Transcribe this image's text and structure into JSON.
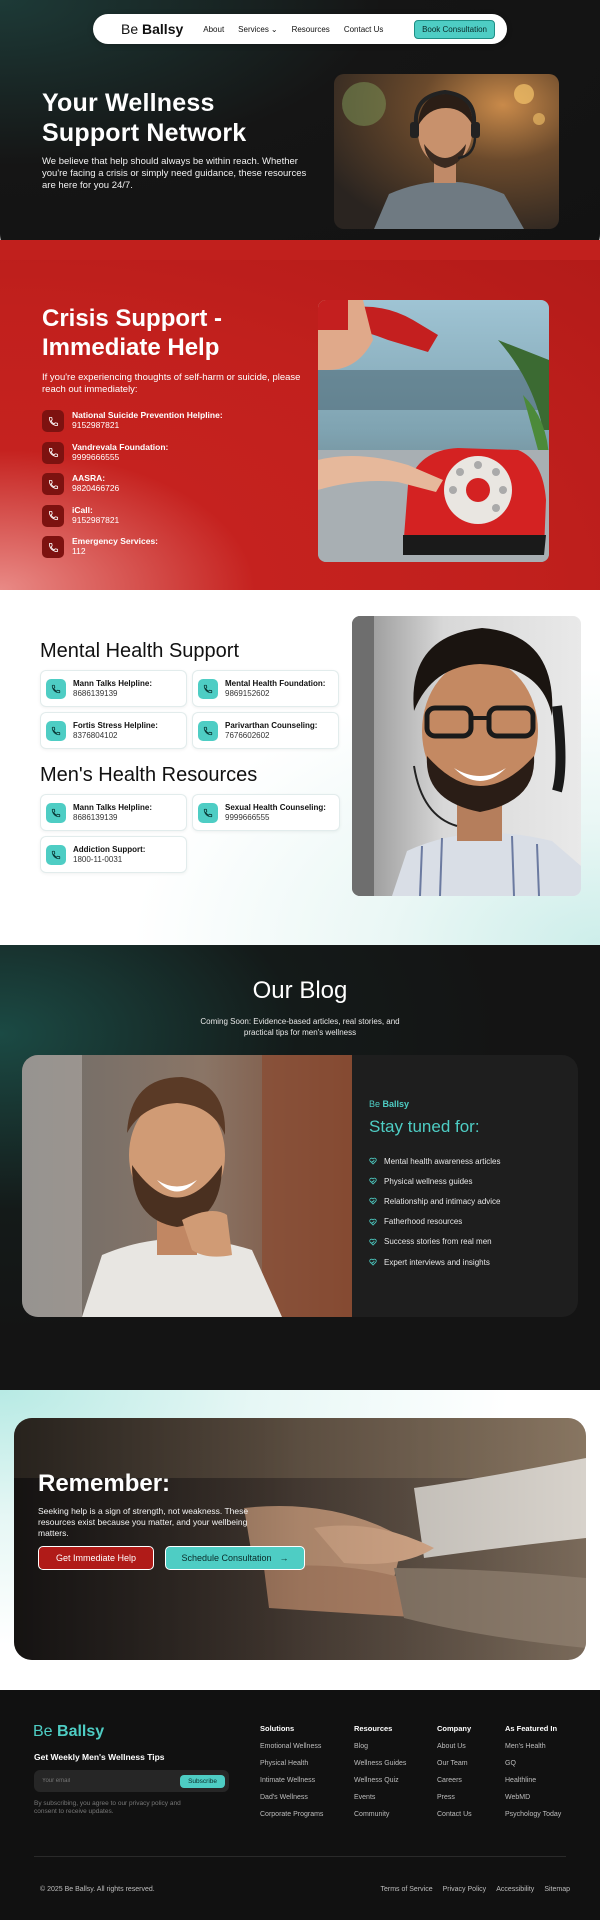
{
  "nav": {
    "logo_prefix": "Be",
    "logo_name": "Ballsy",
    "links": [
      "About",
      "Services",
      "Resources",
      "Contact Us"
    ],
    "cta": "Book Consultation"
  },
  "hero": {
    "title": "Your Wellness Support Network",
    "text": "We believe that help should always be within reach. Whether you're facing a crisis or simply need guidance, these resources are here for you 24/7."
  },
  "crisis": {
    "title": "Crisis Support - Immediate Help",
    "lead": "If you're experiencing thoughts of self-harm or suicide, please reach out immediately:",
    "items": [
      {
        "name": "National Suicide Prevention Helpline:",
        "number": "9152987821"
      },
      {
        "name": "Vandrevala Foundation:",
        "number": "9999666555"
      },
      {
        "name": "AASRA:",
        "number": "9820466726"
      },
      {
        "name": "iCall:",
        "number": "9152987821"
      },
      {
        "name": "Emergency Services:",
        "number": "112"
      }
    ]
  },
  "mental": {
    "title": "Mental Health Support",
    "cards": [
      {
        "name": "Mann Talks Helpline:",
        "number": "8686139139"
      },
      {
        "name": "Mental Health Foundation:",
        "number": "9869152602"
      },
      {
        "name": "Fortis Stress Helpline:",
        "number": "8376804102"
      },
      {
        "name": "Parivarthan Counseling:",
        "number": "7676602602"
      }
    ]
  },
  "mens": {
    "title": "Men's Health Resources",
    "cards": [
      {
        "name": "Mann Talks Helpline:",
        "number": "8686139139"
      },
      {
        "name": "Sexual Health Counseling:",
        "number": "9999666555"
      },
      {
        "name": "Addiction Support:",
        "number": "1800-11-0031"
      }
    ]
  },
  "blog": {
    "title": "Our Blog",
    "subtitle": "Coming Soon: Evidence-based articles, real stories, and practical tips for men's wellness",
    "brand_prefix": "Be",
    "brand_name": "Ballsy",
    "heading": "Stay tuned for:",
    "items": [
      "Mental health awareness articles",
      "Physical wellness guides",
      "Relationship and intimacy advice",
      "Fatherhood resources",
      "Success stories from real men",
      "Expert interviews and insights"
    ]
  },
  "remember": {
    "title": "Remember:",
    "text": "Seeking help is a sign of strength, not weakness. These resources exist because you matter, and your wellbeing matters.",
    "btn_help": "Get Immediate Help",
    "btn_schedule": "Schedule Consultation"
  },
  "footer": {
    "logo_prefix": "Be",
    "logo_name": "Ballsy",
    "tips": "Get Weekly Men's Wellness Tips",
    "email_placeholder": "Your email",
    "subscribe": "Subscribe",
    "fine": "By subscribing, you agree to our privacy policy and consent to receive updates.",
    "columns": [
      {
        "heading": "Solutions",
        "links": [
          "Emotional Wellness",
          "Physical Health",
          "Intimate Wellness",
          "Dad's Wellness",
          "Corporate Programs"
        ]
      },
      {
        "heading": "Resources",
        "links": [
          "Blog",
          "Wellness Guides",
          "Wellness Quiz",
          "Events",
          "Community"
        ]
      },
      {
        "heading": "Company",
        "links": [
          "About Us",
          "Our Team",
          "Careers",
          "Press",
          "Contact Us"
        ]
      },
      {
        "heading": "As Featured In",
        "links": [
          "Men's Health",
          "GQ",
          "Healthline",
          "WebMD",
          "Psychology Today"
        ]
      }
    ],
    "copyright": "© 2025 Be Ballsy. All rights reserved.",
    "legal": [
      "Terms of Service",
      "Privacy Policy",
      "Accessibility",
      "Sitemap"
    ]
  },
  "colors": {
    "teal": "#4ecdc4",
    "red": "#c1201d",
    "dark": "#141414"
  }
}
